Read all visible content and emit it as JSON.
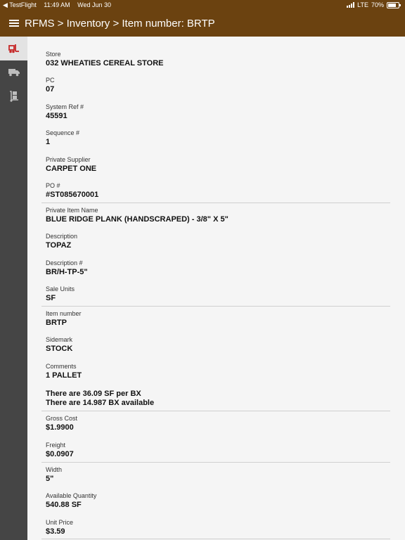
{
  "status_bar": {
    "back_app": "◀ TestFlight",
    "time": "11:49 AM",
    "date": "Wed Jun 30",
    "network": "LTE",
    "battery": "70%"
  },
  "header": {
    "breadcrumb": "RFMS > Inventory > Item number: BRTP"
  },
  "sidebar": {
    "items": [
      {
        "icon": "forklift-icon",
        "active": true
      },
      {
        "icon": "truck-icon",
        "active": false
      },
      {
        "icon": "dolly-icon",
        "active": false
      }
    ]
  },
  "details": {
    "store": {
      "label": "Store",
      "value": "032 WHEATIES CEREAL STORE"
    },
    "pc": {
      "label": "PC",
      "value": "07"
    },
    "system_ref": {
      "label": "System Ref #",
      "value": "45591"
    },
    "sequence": {
      "label": "Sequence #",
      "value": "1"
    },
    "private_supplier": {
      "label": "Private Supplier",
      "value": "CARPET ONE"
    },
    "po": {
      "label": "PO #",
      "value": "#ST085670001"
    },
    "private_item_name": {
      "label": "Private Item Name",
      "value": "BLUE RIDGE PLANK (HANDSCRAPED) - 3/8\" X 5\""
    },
    "description": {
      "label": "Description",
      "value": "TOPAZ"
    },
    "description_num": {
      "label": "Description #",
      "value": "BR/H-TP-5\""
    },
    "sale_units": {
      "label": "Sale Units",
      "value": "SF"
    },
    "item_number": {
      "label": "Item number",
      "value": "BRTP"
    },
    "sidemark": {
      "label": "Sidemark",
      "value": "STOCK"
    },
    "comments": {
      "label": "Comments",
      "value": "1 PALLET"
    },
    "per_box": "There are 36.09 SF per BX",
    "available_box": "There are 14.987 BX available",
    "gross_cost": {
      "label": "Gross Cost",
      "value": "$1.9900"
    },
    "freight": {
      "label": "Freight",
      "value": "$0.0907"
    },
    "width": {
      "label": "Width",
      "value": "5\""
    },
    "available_quantity": {
      "label": "Available Quantity",
      "value": "540.88 SF"
    },
    "unit_price": {
      "label": "Unit Price",
      "value": "$3.59"
    }
  },
  "colors": {
    "header": "#6b4210",
    "sidebar": "#454545",
    "active_icon": "#c62828"
  }
}
